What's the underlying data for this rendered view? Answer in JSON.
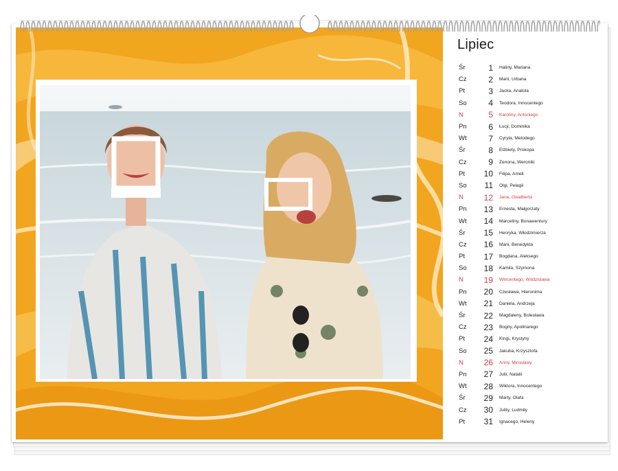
{
  "calendar": {
    "month": "Lipiec",
    "days": [
      {
        "dow": "Śr",
        "day": "1",
        "names": "Haliny, Mariana",
        "sunday": false
      },
      {
        "dow": "Cz",
        "day": "2",
        "names": "Marii, Urbana",
        "sunday": false
      },
      {
        "dow": "Pt",
        "day": "3",
        "names": "Jacka, Anatola",
        "sunday": false
      },
      {
        "dow": "So",
        "day": "4",
        "names": "Teodora, Innocentego",
        "sunday": false
      },
      {
        "dow": "N",
        "day": "5",
        "names": "Karoliny, Antoniego",
        "sunday": true
      },
      {
        "dow": "Pn",
        "day": "6",
        "names": "Łucji, Dominika",
        "sunday": false
      },
      {
        "dow": "Wt",
        "day": "7",
        "names": "Cyryla, Metodego",
        "sunday": false
      },
      {
        "dow": "Śr",
        "day": "8",
        "names": "Elżbiety, Prokopa",
        "sunday": false
      },
      {
        "dow": "Cz",
        "day": "9",
        "names": "Zenona, Weroniki",
        "sunday": false
      },
      {
        "dow": "Pt",
        "day": "10",
        "names": "Filipa, Ameli",
        "sunday": false
      },
      {
        "dow": "So",
        "day": "11",
        "names": "Olgi, Pelagii",
        "sunday": false
      },
      {
        "dow": "N",
        "day": "12",
        "names": "Jana, Gwalberta",
        "sunday": true
      },
      {
        "dow": "Pn",
        "day": "13",
        "names": "Ernesta, Małgorzaty",
        "sunday": false
      },
      {
        "dow": "Wt",
        "day": "14",
        "names": "Marceliny, Bonawentury",
        "sunday": false
      },
      {
        "dow": "Śr",
        "day": "15",
        "names": "Henryka, Włodzimierza",
        "sunday": false
      },
      {
        "dow": "Cz",
        "day": "16",
        "names": "Marii, Benedykta",
        "sunday": false
      },
      {
        "dow": "Pt",
        "day": "17",
        "names": "Bogdana, Aleksego",
        "sunday": false
      },
      {
        "dow": "So",
        "day": "18",
        "names": "Kamila, Szymona",
        "sunday": false
      },
      {
        "dow": "N",
        "day": "19",
        "names": "Wincentego, Wodzisława",
        "sunday": true
      },
      {
        "dow": "Pn",
        "day": "20",
        "names": "Czesława, Hieronima",
        "sunday": false
      },
      {
        "dow": "Wt",
        "day": "21",
        "names": "Daniela, Andrzeja",
        "sunday": false
      },
      {
        "dow": "Śr",
        "day": "22",
        "names": "Magdaleny, Bolesława",
        "sunday": false
      },
      {
        "dow": "Cz",
        "day": "23",
        "names": "Bogny, Apolinarego",
        "sunday": false
      },
      {
        "dow": "Pt",
        "day": "24",
        "names": "Kingi, Krystyny",
        "sunday": false
      },
      {
        "dow": "So",
        "day": "25",
        "names": "Jakuba, Krzysztofa",
        "sunday": false
      },
      {
        "dow": "N",
        "day": "26",
        "names": "Anny, Mirosławy",
        "sunday": true
      },
      {
        "dow": "Pn",
        "day": "27",
        "names": "Julii, Natalii",
        "sunday": false
      },
      {
        "dow": "Wt",
        "day": "28",
        "names": "Wiktora, Innocentego",
        "sunday": false
      },
      {
        "dow": "Śr",
        "day": "29",
        "names": "Marty, Olafa",
        "sunday": false
      },
      {
        "dow": "Cz",
        "day": "30",
        "names": "Julity, Ludmiły",
        "sunday": false
      },
      {
        "dow": "Pt",
        "day": "31",
        "names": "Ignacego, Heleny",
        "sunday": false
      }
    ]
  },
  "colors": {
    "background_marble": "#f2a51e",
    "sunday_text": "#d43b42",
    "regular_text": "#222222"
  }
}
